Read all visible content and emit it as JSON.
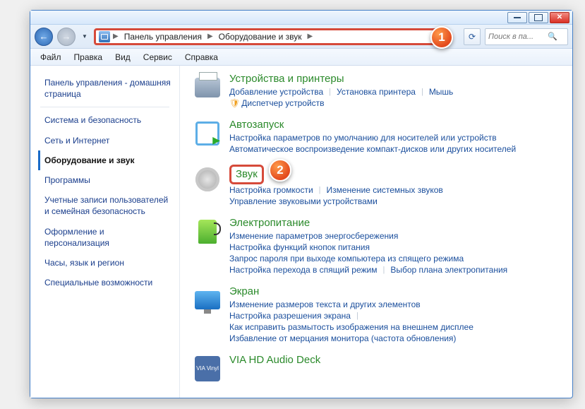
{
  "callouts": {
    "one": "1",
    "two": "2"
  },
  "window": {
    "close_x": "✕"
  },
  "address": {
    "seg1": "Панель управления",
    "seg2": "Оборудование и звук"
  },
  "search": {
    "placeholder": "Поиск в па..."
  },
  "menu": {
    "file": "Файл",
    "edit": "Правка",
    "view": "Вид",
    "tools": "Сервис",
    "help": "Справка"
  },
  "sidebar": {
    "home": "Панель управления - домашняя страница",
    "items": [
      "Система и безопасность",
      "Сеть и Интернет",
      "Оборудование и звук",
      "Программы",
      "Учетные записи пользователей и семейная безопасность",
      "Оформление и персонализация",
      "Часы, язык и регион",
      "Специальные возможности"
    ]
  },
  "sections": {
    "devices": {
      "title": "Устройства и принтеры",
      "l1": "Добавление устройства",
      "l2": "Установка принтера",
      "l3": "Мышь",
      "l4": "Диспетчер устройств"
    },
    "autorun": {
      "title": "Автозапуск",
      "l1": "Настройка параметров по умолчанию для носителей или устройств",
      "l2": "Автоматическое воспроизведение компакт-дисков или других носителей"
    },
    "sound": {
      "title": "Звук",
      "l1": "Настройка громкости",
      "l2": "Изменение системных звуков",
      "l3": "Управление звуковыми устройствами"
    },
    "power": {
      "title": "Электропитание",
      "l1": "Изменение параметров энергосбережения",
      "l2": "Настройка функций кнопок питания",
      "l3": "Запрос пароля при выходе компьютера из спящего режима",
      "l4": "Настройка перехода в спящий режим",
      "l5": "Выбор плана электропитания"
    },
    "screen": {
      "title": "Экран",
      "l1": "Изменение размеров текста и других элементов",
      "l2": "Настройка разрешения экрана",
      "l3": "Как исправить размытость изображения на внешнем дисплее",
      "l4": "Избавление от мерцания монитора (частота обновления)"
    },
    "via": {
      "title": "VIA HD Audio Deck",
      "ic": "VIA Vinyl"
    }
  }
}
